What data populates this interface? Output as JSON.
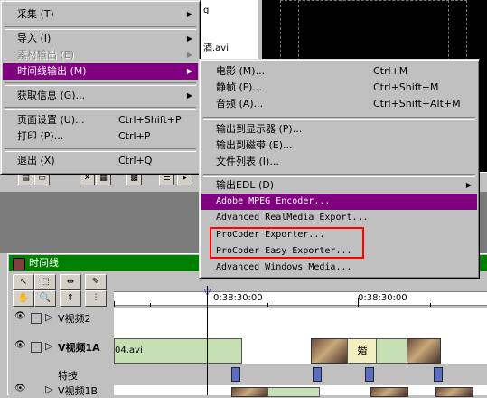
{
  "project_window": {
    "list_items": [
      "g",
      "",
      "酒.avi",
      ""
    ],
    "toolbar_icons": [
      "list-view-icon",
      "new-bin-icon",
      "delete-icon",
      "thumbnail-view-icon",
      "icon-view-icon",
      "list-mode-icon",
      "menu-icon"
    ]
  },
  "main_menu": {
    "items": [
      {
        "label": "采集 (T)",
        "shortcut": "",
        "submenu": true,
        "disabled": false,
        "selected": false
      },
      {
        "label": "导入 (I)",
        "shortcut": "",
        "submenu": true,
        "disabled": false,
        "selected": false
      },
      {
        "label": "素材输出 (E)",
        "shortcut": "",
        "submenu": true,
        "disabled": true,
        "selected": false
      },
      {
        "label": "时间线输出 (M)",
        "shortcut": "",
        "submenu": true,
        "disabled": false,
        "selected": true
      },
      {
        "label": "获取信息 (G)...",
        "shortcut": "",
        "submenu": true,
        "disabled": false,
        "selected": false
      },
      {
        "label": "页面设置 (U)...",
        "shortcut": "Ctrl+Shift+P",
        "submenu": false,
        "disabled": false,
        "selected": false
      },
      {
        "label": "打印 (P)...",
        "shortcut": "Ctrl+P",
        "submenu": false,
        "disabled": false,
        "selected": false
      },
      {
        "label": "退出 (X)",
        "shortcut": "Ctrl+Q",
        "submenu": false,
        "disabled": false,
        "selected": false
      }
    ]
  },
  "sub_menu": {
    "items": [
      {
        "label": "电影 (M)...",
        "shortcut": "Ctrl+M",
        "selected": false
      },
      {
        "label": "静帧 (F)...",
        "shortcut": "Ctrl+Shift+M",
        "selected": false
      },
      {
        "label": "音频 (A)...",
        "shortcut": "Ctrl+Shift+Alt+M",
        "selected": false
      },
      {
        "label": "输出到显示器 (P)...",
        "shortcut": "",
        "selected": false
      },
      {
        "label": "输出到磁带 (E)...",
        "shortcut": "",
        "selected": false
      },
      {
        "label": "文件列表 (I)...",
        "shortcut": "",
        "selected": false
      },
      {
        "label": "输出EDL (D)",
        "shortcut": "",
        "submenu": true,
        "selected": false
      },
      {
        "label": "Adobe MPEG Encoder...",
        "shortcut": "",
        "selected": true
      },
      {
        "label": "Advanced RealMedia Export...",
        "shortcut": "",
        "selected": false
      },
      {
        "label": "ProCoder Exporter...",
        "shortcut": "",
        "selected": false
      },
      {
        "label": "ProCoder Easy Exporter...",
        "shortcut": "",
        "selected": false
      },
      {
        "label": "Advanced Windows Media...",
        "shortcut": "",
        "selected": false
      }
    ]
  },
  "timeline": {
    "title": "时间线",
    "time_labels": [
      "0:38:30:00",
      "0:38:30:00"
    ],
    "tracks": {
      "video2": "V视频2",
      "video1a": "V视频1A",
      "fx": "特技",
      "video1b": "V视频1B"
    },
    "clip_label": "04.avi",
    "transition_label": "婚"
  },
  "colors": {
    "menu_highlight": "#800080",
    "timeline_title": "#008000",
    "annotation_box": "#ff0000"
  }
}
